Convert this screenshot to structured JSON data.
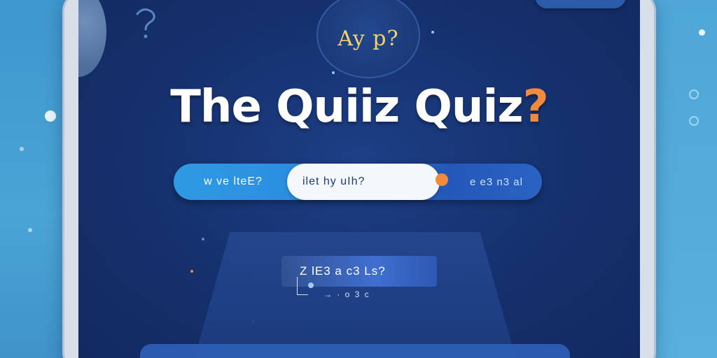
{
  "app": {
    "logo_text": "Ay p?",
    "title_main": "The Quiiz Quiz",
    "title_mark": "?"
  },
  "segmented_bar": {
    "left_label": "w ve lteE?",
    "middle_label": "ilet hy uIh?",
    "right_label": "e e3 n3 al"
  },
  "question_card": {
    "prompt": "Z lE3 a  c3 Ls?",
    "sub_text": "→ ·  o 3  c"
  },
  "colors": {
    "screen_bg": "#15306d",
    "accent_orange": "#f08a3c",
    "accent_blue": "#2f9ae3",
    "title_white": "#ffffff"
  },
  "icons": {
    "question_mark_deco": "question-mark-icon",
    "logo": "quiz-logo-icon"
  }
}
